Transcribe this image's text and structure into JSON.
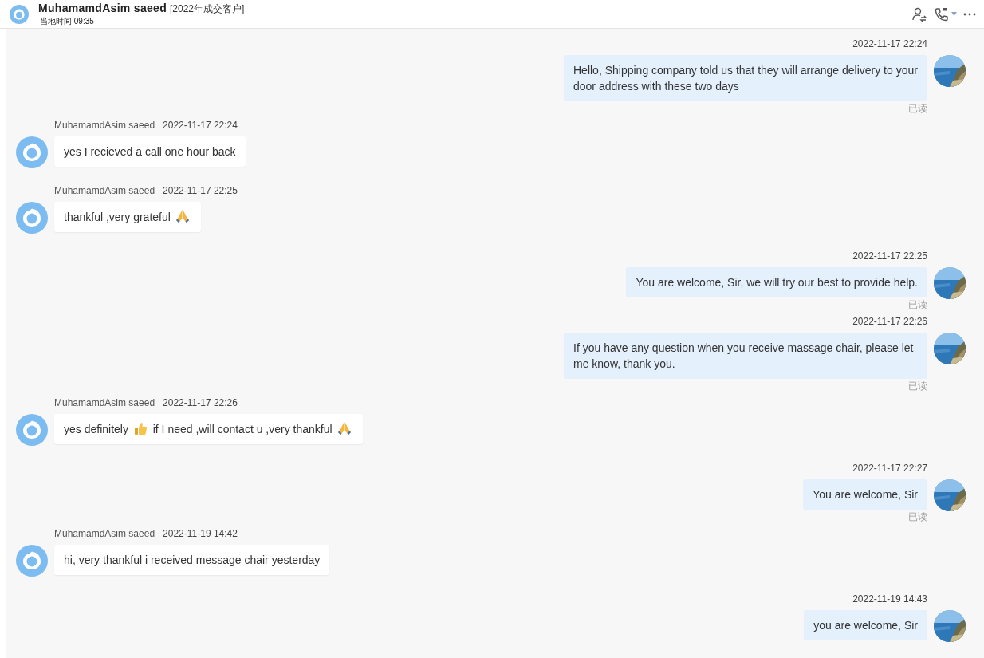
{
  "header": {
    "name": "MuhamamdAsim saeed",
    "tag": "[2022年成交客户]",
    "local_time": "当地时间 09:35"
  },
  "messages": [
    {
      "kind": "outgoing",
      "time": "2022-11-17 22:24",
      "parts": [
        {
          "kind": "text",
          "text": "Hello, Shipping company told us that they will arrange delivery to your door address with these two days"
        }
      ],
      "status": "已读"
    },
    {
      "kind": "incoming",
      "sender": "MuhamamdAsim saeed",
      "time": "2022-11-17 22:24",
      "parts": [
        {
          "kind": "text",
          "text": "yes I recieved a call one hour back"
        }
      ]
    },
    {
      "kind": "incoming",
      "sender": "MuhamamdAsim saeed",
      "time": "2022-11-17 22:25",
      "parts": [
        {
          "kind": "text",
          "text": "thankful ,very grateful"
        },
        {
          "kind": "pray"
        }
      ]
    },
    {
      "kind": "outgoing",
      "time": "2022-11-17 22:25",
      "parts": [
        {
          "kind": "text",
          "text": "You are welcome, Sir, we will try our best to provide help."
        }
      ],
      "status": "已读"
    },
    {
      "kind": "outgoing",
      "time": "2022-11-17 22:26",
      "parts": [
        {
          "kind": "text",
          "text": "If you have any question when you receive massage chair, please let me know, thank you."
        }
      ],
      "status": "已读"
    },
    {
      "kind": "incoming",
      "sender": "MuhamamdAsim saeed",
      "time": "2022-11-17 22:26",
      "parts": [
        {
          "kind": "text",
          "text": "yes definitely"
        },
        {
          "kind": "thumbs"
        },
        {
          "kind": "text",
          "text": "if I need ,will contact u ,very thankful"
        },
        {
          "kind": "pray"
        }
      ]
    },
    {
      "kind": "outgoing",
      "time": "2022-11-17 22:27",
      "parts": [
        {
          "kind": "text",
          "text": "You are welcome, Sir"
        }
      ],
      "status": "已读"
    },
    {
      "kind": "incoming",
      "sender": "MuhamamdAsim saeed",
      "time": "2022-11-19 14:42",
      "parts": [
        {
          "kind": "text",
          "text": "hi, very thankful i received message chair yesterday"
        }
      ]
    },
    {
      "kind": "outgoing",
      "time": "2022-11-19 14:43",
      "parts": [
        {
          "kind": "text",
          "text": "you are welcome, Sir"
        }
      ]
    }
  ]
}
